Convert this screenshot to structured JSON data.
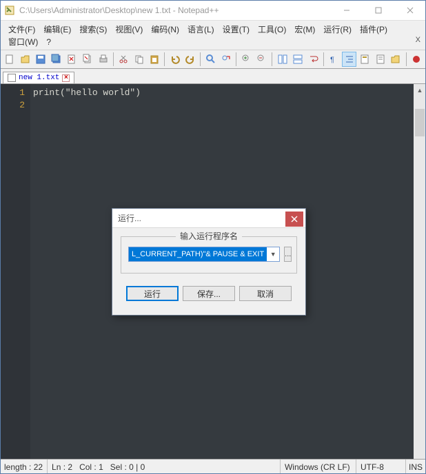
{
  "titlebar": {
    "title": "C:\\Users\\Administrator\\Desktop\\new 1.txt - Notepad++"
  },
  "menu": {
    "file": "文件(F)",
    "edit": "编辑(E)",
    "search": "搜索(S)",
    "view": "视图(V)",
    "encoding": "编码(N)",
    "language": "语言(L)",
    "settings": "设置(T)",
    "tools": "工具(O)",
    "macro": "宏(M)",
    "run": "运行(R)",
    "plugins": "插件(P)",
    "window": "窗口(W)",
    "help": "?"
  },
  "tab": {
    "name": "new 1.txt"
  },
  "editor": {
    "line1": "print(\"hello world\")",
    "gutter": [
      "1",
      "2"
    ]
  },
  "dialog": {
    "title": "运行...",
    "group_label": "输入运行程序名",
    "input_value": "L_CURRENT_PATH)\"& PAUSE & EXIT",
    "browse": "...",
    "run_btn": "运行",
    "save_btn": "保存...",
    "cancel_btn": "取消"
  },
  "status": {
    "length": "length : 22",
    "lines": "Ln : 2",
    "col": "Col : 1",
    "sel": "Sel : 0 | 0",
    "eol": "Windows (CR LF)",
    "encoding": "UTF-8",
    "mode": "INS"
  }
}
